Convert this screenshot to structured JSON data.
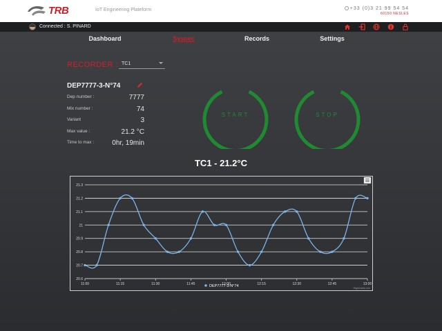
{
  "header": {
    "logo_text": "TRB",
    "subtitle": "IoT Engineering Plateform",
    "phone": "+33 (0)3 21 99 54 54",
    "address": "60150 NESLES"
  },
  "userbar": {
    "connected_text": "Connected : S. PINARD",
    "icons": [
      "home-icon",
      "sign-in-icon",
      "globe-icon",
      "info-icon",
      "lock-icon"
    ]
  },
  "nav": {
    "items": [
      {
        "label": "Dashboard",
        "active": false
      },
      {
        "label": "Syspec",
        "active": true
      },
      {
        "label": "Records",
        "active": false
      },
      {
        "label": "Settings",
        "active": false
      }
    ]
  },
  "recorder": {
    "label": "RECORDER :",
    "selected": "TC1",
    "name": "DEP7777-3-N°74",
    "fields": [
      {
        "key": "Dep number :",
        "value": "7777"
      },
      {
        "key": "Mix number :",
        "value": "74"
      },
      {
        "key": "Variant",
        "value": "3"
      },
      {
        "key": "Max value :",
        "value": "21.2 °C"
      },
      {
        "key": "Time to max :",
        "value": "0hr, 19min"
      }
    ]
  },
  "controls": {
    "start_label": "START",
    "stop_label": "STOP",
    "accent_color": "#1f8a32"
  },
  "chart_title": "TC1 - 21.2°C",
  "chart_data": {
    "type": "line",
    "title": "TC1 - 21.2°C",
    "xlabel": "",
    "ylabel": "",
    "x_ticks": [
      "11:00",
      "11:15",
      "11:30",
      "11:45",
      "12:00",
      "12:15",
      "12:30",
      "12:45",
      "13:00"
    ],
    "y_ticks": [
      "20.6",
      "20.7",
      "20.8",
      "20.9",
      "21",
      "21.1",
      "21.2",
      "21.3"
    ],
    "ylim": [
      20.6,
      21.3
    ],
    "xlim_minutes_after_11": [
      0,
      120
    ],
    "grid": true,
    "legend": "bottom",
    "series": [
      {
        "name": "DEP7777-3-N°74",
        "color": "#7cb5ec",
        "x": [
          "11:00",
          "11:05",
          "11:10",
          "11:15",
          "11:20",
          "11:25",
          "11:30",
          "11:35",
          "11:40",
          "11:45",
          "11:50",
          "11:55",
          "12:00",
          "12:05",
          "12:10",
          "12:15",
          "12:20",
          "12:25",
          "12:30",
          "12:35",
          "12:40",
          "12:45",
          "12:50",
          "12:55",
          "13:00"
        ],
        "values": [
          20.7,
          20.7,
          21.0,
          21.2,
          21.2,
          21.0,
          20.9,
          20.8,
          20.8,
          20.9,
          21.1,
          21.0,
          21.0,
          20.8,
          20.7,
          20.8,
          21.0,
          21.1,
          21.1,
          20.9,
          20.8,
          20.8,
          20.9,
          21.2,
          21.2
        ]
      }
    ],
    "credit": "Highcharts.com"
  }
}
